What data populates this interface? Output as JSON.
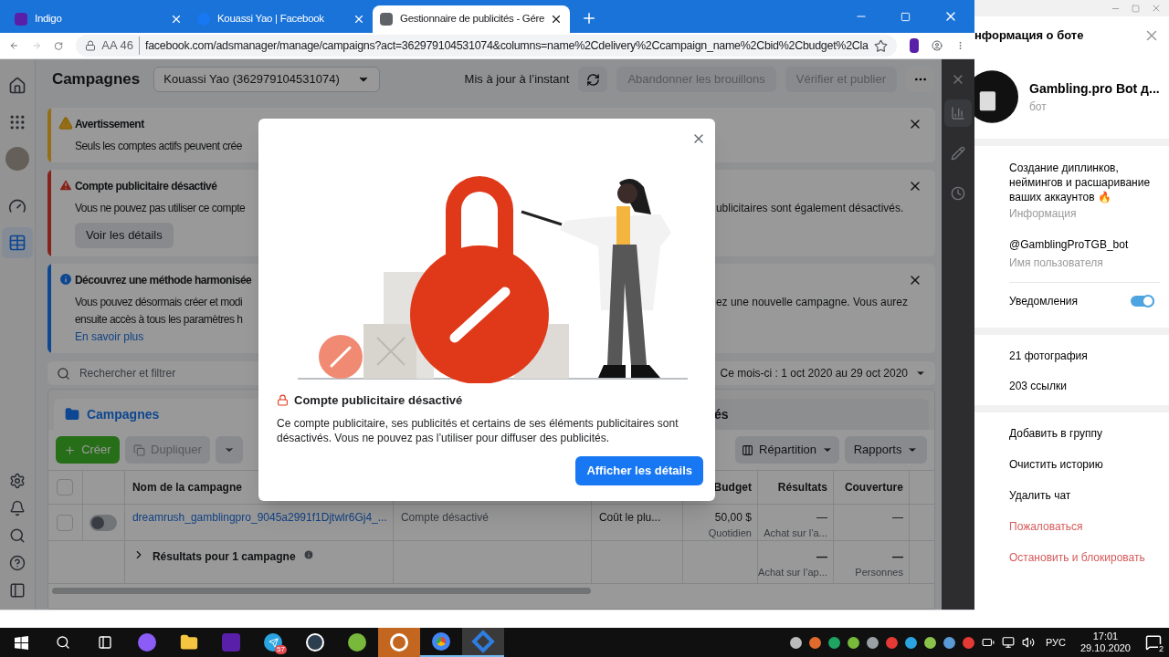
{
  "browser": {
    "tabs": [
      {
        "title": "Indigo",
        "selected": false
      },
      {
        "title": "Kouassi Yao | Facebook",
        "selected": false
      },
      {
        "title": "Gestionnaire de publicités - Gére",
        "selected": true
      }
    ],
    "address": {
      "prefix": "AA 46",
      "url": "facebook.com/adsmanager/manage/campaigns?act=362979104531074&columns=name%2Cdelivery%2Ccampaign_name%2Cbid%2Cbudget%2Cla"
    }
  },
  "ads_manager": {
    "nav": [
      {
        "selected": false
      },
      {
        "selected": false
      },
      {
        "selected": false
      },
      {
        "selected": false
      },
      {
        "selected": true
      }
    ],
    "title": "Campagnes",
    "account": "Kouassi Yao (362979104531074)",
    "status": "Mis à jour à l’instant",
    "discard": "Abandonner les brouillons",
    "publish": "Vérifier et publier",
    "banners": [
      {
        "kind": "warning",
        "title": "Avertissement",
        "lines": [
          {
            "left": "Seuls les comptes actifs peuvent crée"
          }
        ]
      },
      {
        "kind": "error",
        "title": "Compte publicitaire désactivé",
        "lines": [
          {
            "left": "Vous ne pouvez pas utiliser ce compte",
            "right": "ublicitaires sont également désactivés."
          }
        ],
        "button": "Voir les détails"
      },
      {
        "kind": "info",
        "title": "Découvrez une méthode harmonisée",
        "lines": [
          {
            "left": "Vous pouvez désormais créer et modi",
            "right": "ez une nouvelle campagne. Vous aurez"
          },
          {
            "left": "ensuite accès à tous les paramètres h"
          }
        ],
        "link": "En savoir plus"
      }
    ],
    "search": {
      "placeholder": "Rechercher et filtrer"
    },
    "date_range": "Ce mois-ci : 1 oct 2020 au 29 oct 2020",
    "tabs": [
      {
        "label": "Campagnes",
        "selected": true
      },
      {
        "label": "és",
        "selected": false
      }
    ],
    "toolbar": {
      "create": "Créer",
      "duplicate": "Dupliquer",
      "breakdown": "Répartition",
      "reports": "Rapports"
    },
    "table": {
      "all_checked": false,
      "columns": {
        "name": "Nom de la campagne",
        "budget": "Budget",
        "results": "Résultats",
        "reach": "Couverture"
      },
      "rows": [
        {
          "checked": false,
          "on": false,
          "name": "dreamrush_gamblingpro_9045a2991f1Djtwlr6Gj4_...",
          "delivery": "Compte désactivé",
          "bid": "Coût le plu...",
          "budget": "50,00 $",
          "budget_note": "Quotidien",
          "results": "—",
          "results_note": "Achat sur l’a...",
          "reach": "—"
        }
      ],
      "summary": {
        "label": "Résultats pour 1 campagne",
        "results": "—",
        "results_note": "Achat sur l’ap...",
        "reach": "—",
        "reach_note": "Personnes"
      }
    },
    "side_tools": [
      {
        "selected": true
      },
      {
        "selected": false
      },
      {
        "selected": false
      }
    ]
  },
  "dialog": {
    "title": "Compte publicitaire désactivé",
    "body": "Ce compte publicitaire, ses publicités et certains de ses éléments publicitaires sont désactivés. Vous ne pouvez pas l’utiliser pour diffuser des publicités.",
    "button": "Afficher les détails"
  },
  "telegram": {
    "title": "нформация о боте",
    "name": "Gambling.pro Bot д...",
    "subtitle": "бот",
    "about": "Создание диплинков, неймингов и расшаривание ваших аккаунтов 🔥",
    "about_label": "Информация",
    "username": "@GamblingProTGB_bot",
    "username_label": "Имя пользователя",
    "notifications": "Уведомления",
    "notifications_on": true,
    "media": [
      "21 фотография",
      "203 ссылки"
    ],
    "actions": [
      {
        "label": "Добавить в группу",
        "kind": "normal"
      },
      {
        "label": "Очистить историю",
        "kind": "normal"
      },
      {
        "label": "Удалить чат",
        "kind": "normal"
      },
      {
        "label": "Пожаловаться",
        "kind": "danger"
      },
      {
        "label": "Остановить и блокировать",
        "kind": "danger"
      }
    ]
  },
  "taskbar": {
    "telegram_badge": "57",
    "language": "РУС",
    "time": "17:01",
    "date": "29.10.2020",
    "notifications": "2"
  }
}
